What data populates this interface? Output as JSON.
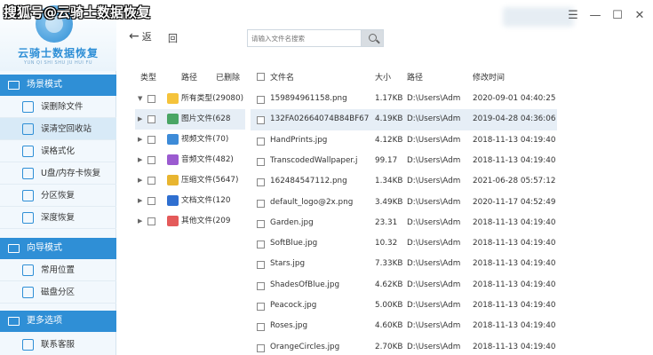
{
  "watermark": "搜狐号@云骑士数据恢复",
  "logo": {
    "title": "云骑士数据恢复",
    "subtitle": "YUN QI SHI SHU JU HUI FU"
  },
  "sidebar": {
    "sections": [
      {
        "title": "场景模式",
        "items": [
          "误删除文件",
          "误清空回收站",
          "误格式化",
          "U盘/内存卡恢复",
          "分区恢复",
          "深度恢复"
        ]
      },
      {
        "title": "向导模式",
        "items": [
          "常用位置",
          "磁盘分区"
        ]
      },
      {
        "title": "更多选项",
        "items": [
          "联系客服"
        ]
      }
    ],
    "active_item": "误清空回收站"
  },
  "toolbar": {
    "back_label": "返",
    "back_arrow": "←",
    "refresh_label": "回",
    "search_placeholder": "请输入文件名搜索"
  },
  "window_controls": [
    "☰",
    "—",
    "☐",
    "✕"
  ],
  "tree": {
    "headers": {
      "type": "类型",
      "path": "路径",
      "deleted": "已删除"
    },
    "rows": [
      {
        "arrow": "▼",
        "label": "所有类型(29080)",
        "icon": "folder-icon",
        "color": "#f5c33b"
      },
      {
        "arrow": "▶",
        "label": "图片文件(628",
        "icon": "image-icon",
        "color": "#4aa564"
      },
      {
        "arrow": "▶",
        "label": "视频文件(70)",
        "icon": "video-icon",
        "color": "#3d8bd8"
      },
      {
        "arrow": "▶",
        "label": "音频文件(482)",
        "icon": "audio-icon",
        "color": "#9b5bd0"
      },
      {
        "arrow": "▶",
        "label": "压缩文件(5647)",
        "icon": "zip-icon",
        "color": "#e8b530"
      },
      {
        "arrow": "▶",
        "label": "文档文件(120",
        "icon": "doc-icon",
        "color": "#2f6fd0"
      },
      {
        "arrow": "▶",
        "label": "其他文件(209",
        "icon": "other-icon",
        "color": "#e45a5a"
      }
    ]
  },
  "table": {
    "headers": {
      "name": "文件名",
      "size": "大小",
      "path": "路径",
      "mtime": "修改时间"
    },
    "rows": [
      {
        "name": "159894961158.png",
        "size": "1.17KB",
        "path": "D:\\Users\\Adm",
        "mtime": "2020-09-01 04:40:25"
      },
      {
        "name": "132FA02664074B84BF67",
        "size": "4.19KB",
        "path": "D:\\Users\\Adm",
        "mtime": "2019-04-28 04:36:06"
      },
      {
        "name": "HandPrints.jpg",
        "size": "4.12KB",
        "path": "D:\\Users\\Adm",
        "mtime": "2018-11-13 04:19:40"
      },
      {
        "name": "TranscodedWallpaper.j",
        "size": "99.17",
        "path": "D:\\Users\\Adm",
        "mtime": "2018-11-13 04:19:40"
      },
      {
        "name": "162484547112.png",
        "size": "1.34KB",
        "path": "D:\\Users\\Adm",
        "mtime": "2021-06-28 05:57:12"
      },
      {
        "name": "default_logo@2x.png",
        "size": "3.49KB",
        "path": "D:\\Users\\Adm",
        "mtime": "2020-11-17 04:52:49"
      },
      {
        "name": "Garden.jpg",
        "size": "23.31",
        "path": "D:\\Users\\Adm",
        "mtime": "2018-11-13 04:19:40"
      },
      {
        "name": "SoftBlue.jpg",
        "size": "10.32",
        "path": "D:\\Users\\Adm",
        "mtime": "2018-11-13 04:19:40"
      },
      {
        "name": "Stars.jpg",
        "size": "7.33KB",
        "path": "D:\\Users\\Adm",
        "mtime": "2018-11-13 04:19:40"
      },
      {
        "name": "ShadesOfBlue.jpg",
        "size": "4.62KB",
        "path": "D:\\Users\\Adm",
        "mtime": "2018-11-13 04:19:40"
      },
      {
        "name": "Peacock.jpg",
        "size": "5.00KB",
        "path": "D:\\Users\\Adm",
        "mtime": "2018-11-13 04:19:40"
      },
      {
        "name": "Roses.jpg",
        "size": "4.60KB",
        "path": "D:\\Users\\Adm",
        "mtime": "2018-11-13 04:19:40"
      },
      {
        "name": "OrangeCircles.jpg",
        "size": "2.70KB",
        "path": "D:\\Users\\Adm",
        "mtime": "2018-11-13 04:19:40"
      }
    ]
  },
  "colors": {
    "accent": "#2f8fd6",
    "highlight": "#e6eef6",
    "sidebar_bg": "#f2f8fd"
  }
}
